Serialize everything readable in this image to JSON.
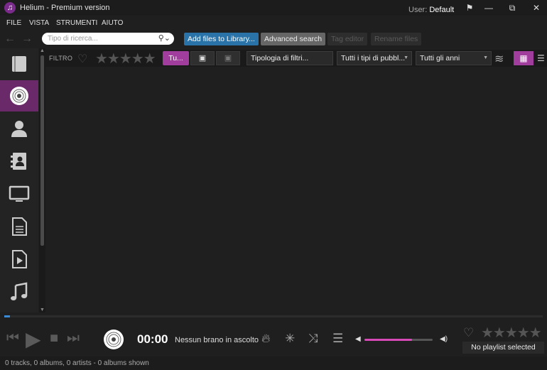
{
  "window": {
    "title": "Helium - Premium version",
    "user_label": "User:",
    "user_name": "Default"
  },
  "menu": [
    "FILE",
    "VISTA",
    "STRUMENTI",
    "AIUTO"
  ],
  "toolbar": {
    "search_placeholder": "Tipo di ricerca...",
    "add_files": "Add files to Library...",
    "advanced_search": "Advanced search",
    "tag_editor": "Tag editor",
    "rename_files": "Rename files"
  },
  "sidebar": {
    "active_item": "albums",
    "items": [
      "books-icon",
      "disc-icon",
      "artist-icon",
      "contacts-icon",
      "monitor-icon",
      "document-icon",
      "video-file-icon",
      "music-note-icon"
    ]
  },
  "filter": {
    "label": "FILTRO",
    "active_pill": "Tu...",
    "type_filter": "Tipologia di filtri...",
    "publication_filter": "Tutti i tipi di pubbl...",
    "year_filter": "Tutti gli anni"
  },
  "player": {
    "time": "00:00",
    "now_playing": "Nessun brano in ascolto",
    "progress": 0.01,
    "volume": 0.7,
    "playlist_status": "No playlist selected"
  },
  "status": {
    "text": "0 tracks, 0 albums, 0 artists - 0 albums shown"
  },
  "colors": {
    "accent": "#a13d9c",
    "button_blue": "#2a73a8",
    "progress_blue": "#3a8ad6",
    "volume_pink": "#d649b6"
  }
}
